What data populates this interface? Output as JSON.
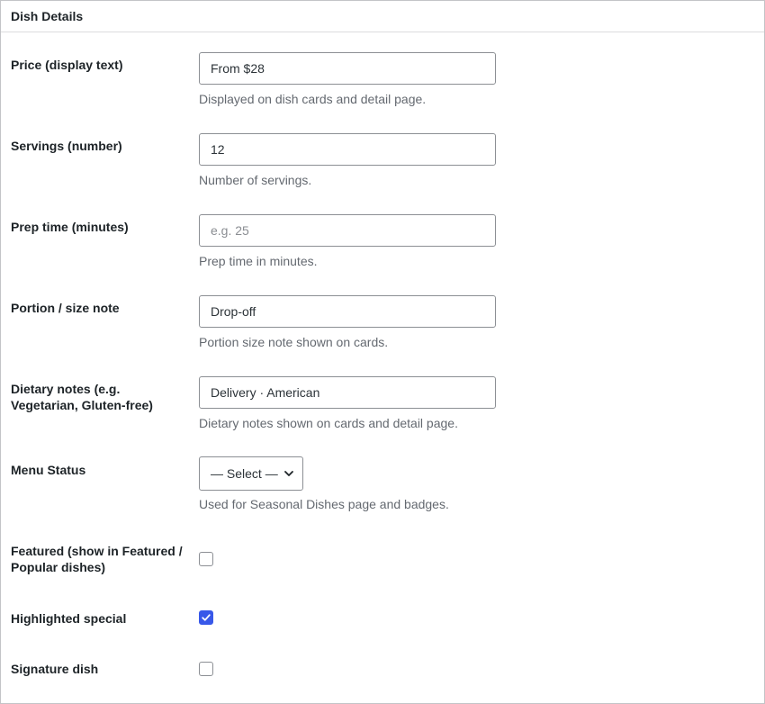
{
  "panel": {
    "title": "Dish Details"
  },
  "fields": {
    "price": {
      "label": "Price (display text)",
      "value": "From $28",
      "placeholder": "",
      "description": "Displayed on dish cards and detail page."
    },
    "servings": {
      "label": "Servings (number)",
      "value": "12",
      "placeholder": "",
      "description": "Number of servings."
    },
    "prep_time": {
      "label": "Prep time (minutes)",
      "value": "",
      "placeholder": "e.g. 25",
      "description": "Prep time in minutes."
    },
    "portion": {
      "label": "Portion / size note",
      "value": "Drop-off",
      "placeholder": "",
      "description": "Portion size note shown on cards."
    },
    "dietary": {
      "label_line1": "Dietary notes (e.g.",
      "label_line2": "Vegetarian, Gluten-free)",
      "value": "Delivery · American",
      "placeholder": "",
      "description": "Dietary notes shown on cards and detail page."
    },
    "menu_status": {
      "label": "Menu Status",
      "selected": "— Select —",
      "chevron_icon": "chevron-down-icon",
      "description": "Used for Seasonal Dishes page and badges."
    },
    "featured": {
      "label_line1": "Featured (show in Featured /",
      "label_line2": "Popular dishes)",
      "checked": false
    },
    "highlighted": {
      "label": "Highlighted special",
      "checked": true,
      "check_icon": "checkmark-icon"
    },
    "signature": {
      "label": "Signature dish",
      "checked": false
    }
  },
  "colors": {
    "accent": "#3858e9",
    "border": "#8c8f94",
    "description_text": "#646970"
  }
}
